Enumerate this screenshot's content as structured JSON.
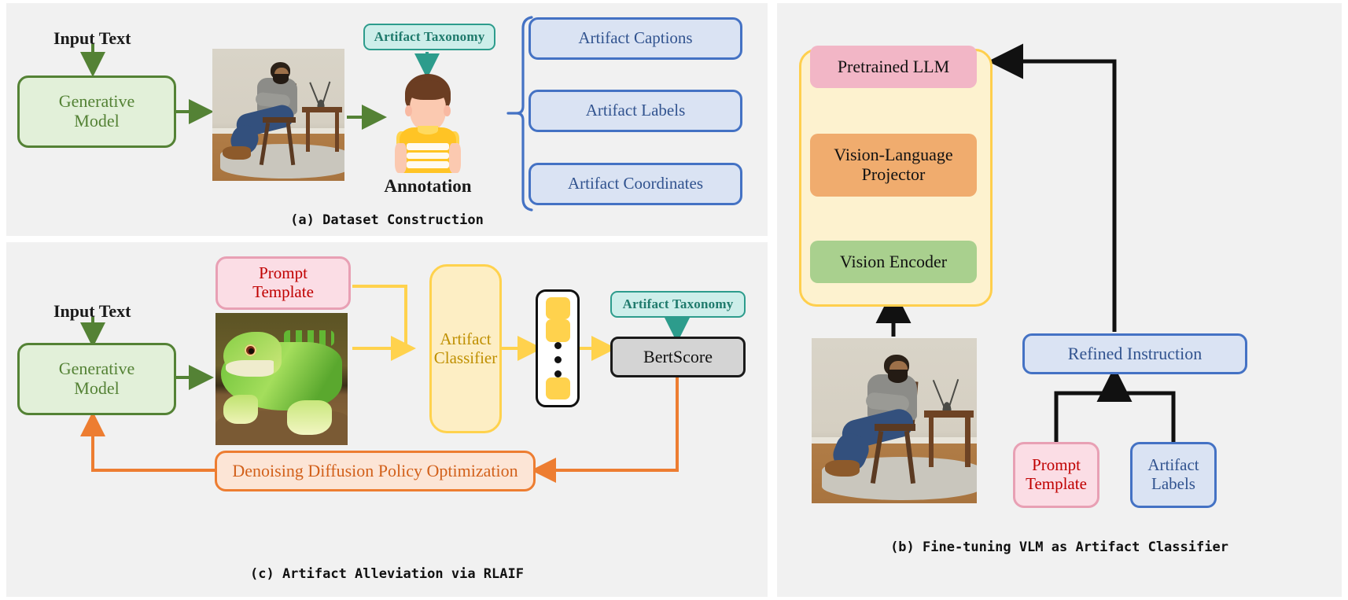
{
  "panels": {
    "a": {
      "caption": "(a) Dataset Construction",
      "input_label": "Input Text",
      "generative_model": "Generative\nModel",
      "taxonomy": "Artifact Taxonomy",
      "annotation_label": "Annotation",
      "outputs": [
        "Artifact Captions",
        "Artifact Labels",
        "Artifact Coordinates"
      ],
      "image_alt": "generated-image-man-on-chair"
    },
    "b": {
      "caption": "(b) Fine-tuning VLM as Artifact Classifier",
      "stack": [
        "Pretrained LLM",
        "Vision-Language\nProjector",
        "Vision Encoder"
      ],
      "refined_instruction": "Refined Instruction",
      "prompt_template": "Prompt\nTemplate",
      "artifact_labels": "Artifact\nLabels",
      "image_alt": "generated-image-man-on-chair"
    },
    "c": {
      "caption": "(c) Artifact Alleviation via RLAIF",
      "input_label": "Input Text",
      "generative_model": "Generative\nModel",
      "prompt_template": "Prompt\nTemplate",
      "artifact_classifier": "Artifact\nClassifier",
      "taxonomy": "Artifact Taxonomy",
      "bertscore": "BertScore",
      "ddpo": "Denoising Diffusion Policy Optimization",
      "image_alt": "generated-image-lizard",
      "token_count_visual": 3
    }
  },
  "colors": {
    "panel_bg": "#f1f1f1",
    "green": "#548235",
    "green_fill": "#e2f0d9",
    "blue": "#4472c4",
    "blue_fill": "#dae3f3",
    "teal": "#2d9c8c",
    "teal_fill": "#cdeeea",
    "pink": "#e8a0b4",
    "pink_fill": "#fbdde5",
    "pink_text": "#c00000",
    "yellow": "#ffd24d",
    "yellow_fill": "#fdeec4",
    "yellow_text": "#bf8f00",
    "orange": "#ed7d31",
    "orange_fill": "#fce5d6",
    "gray_fill": "#d4d4d4",
    "black": "#111111",
    "llm_pink": "#f2b6c6",
    "projector_orange": "#f0ac6e",
    "encoder_green": "#a9d08e"
  }
}
